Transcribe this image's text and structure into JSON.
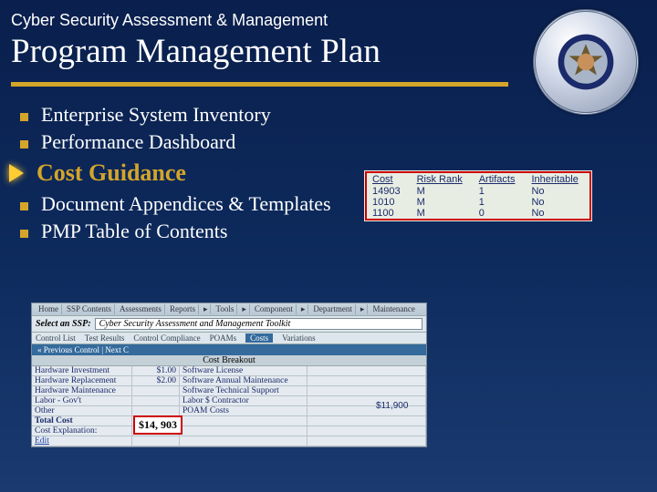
{
  "header": {
    "subtitle": "Cyber Security Assessment & Management",
    "title": "Program Management Plan"
  },
  "bullets": [
    "Enterprise System Inventory",
    "Performance Dashboard"
  ],
  "highlight": "Cost Guidance",
  "bullets2": [
    "Document Appendices & Templates",
    "PMP Table of Contents"
  ],
  "cost_table": {
    "headers": [
      "Cost",
      "Risk Rank",
      "Artifacts",
      "Inheritable"
    ],
    "rows": [
      [
        "14903",
        "M",
        "1",
        "No"
      ],
      [
        "1010",
        "M",
        "1",
        "No"
      ],
      [
        "1100",
        "M",
        "0",
        "No"
      ]
    ]
  },
  "breakout": {
    "toolbar": [
      "Home",
      "SSP Contents",
      "Assessments",
      "Reports",
      "Tools",
      "Component",
      "Department",
      "Maintenance"
    ],
    "select_label": "Select an SSP:",
    "select_value": "Cyber Security Assessment and Management Toolkit",
    "tabs": [
      "Control List",
      "Test Results",
      "Control Compliance",
      "POAMs",
      "Costs",
      "Variations"
    ],
    "sub": "« Previous Control | Next C",
    "head": "Cost Breakout",
    "left_rows": [
      [
        "Hardware Investment",
        "$1.00"
      ],
      [
        "Hardware Replacement",
        "$2.00"
      ],
      [
        "Hardware Maintenance",
        ""
      ],
      [
        "Labor - Gov't",
        ""
      ],
      [
        "Other",
        ""
      ],
      [
        "Total Cost",
        ""
      ],
      [
        "Cost Explanation:",
        ""
      ],
      [
        "Edit",
        ""
      ]
    ],
    "right_rows": [
      "Software License",
      "Software Annual Maintenance",
      "Software Technical Support",
      "Labor $ Contractor",
      "POAM Costs"
    ],
    "poam_val": "$11,900",
    "total": "$14, 903"
  }
}
